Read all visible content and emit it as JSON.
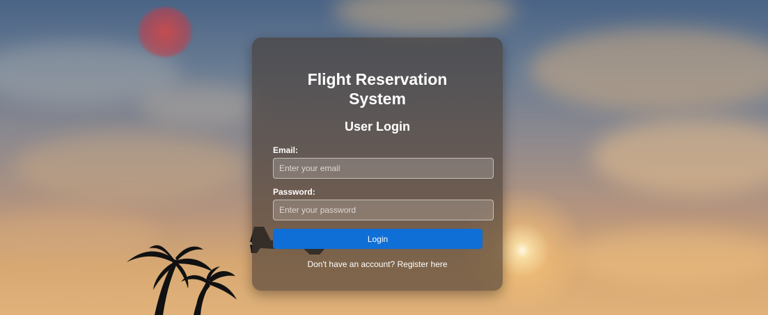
{
  "login": {
    "app_title": "Flight Reservation System",
    "subtitle": "User Login",
    "email_label": "Email:",
    "email_placeholder": "Enter your email",
    "email_value": "",
    "password_label": "Password:",
    "password_placeholder": "Enter your password",
    "password_value": "",
    "login_button": "Login",
    "register_prompt": "Don't have an account?",
    "register_link": "Register here"
  },
  "colors": {
    "accent": "#0f6fd6",
    "card_background": "rgba(70, 58, 50, 0.62)"
  },
  "background": {
    "scene": "sunset sky with clouds",
    "elements": [
      "sun",
      "red-lens-flare",
      "palm-trees",
      "jet-silhouette"
    ]
  }
}
